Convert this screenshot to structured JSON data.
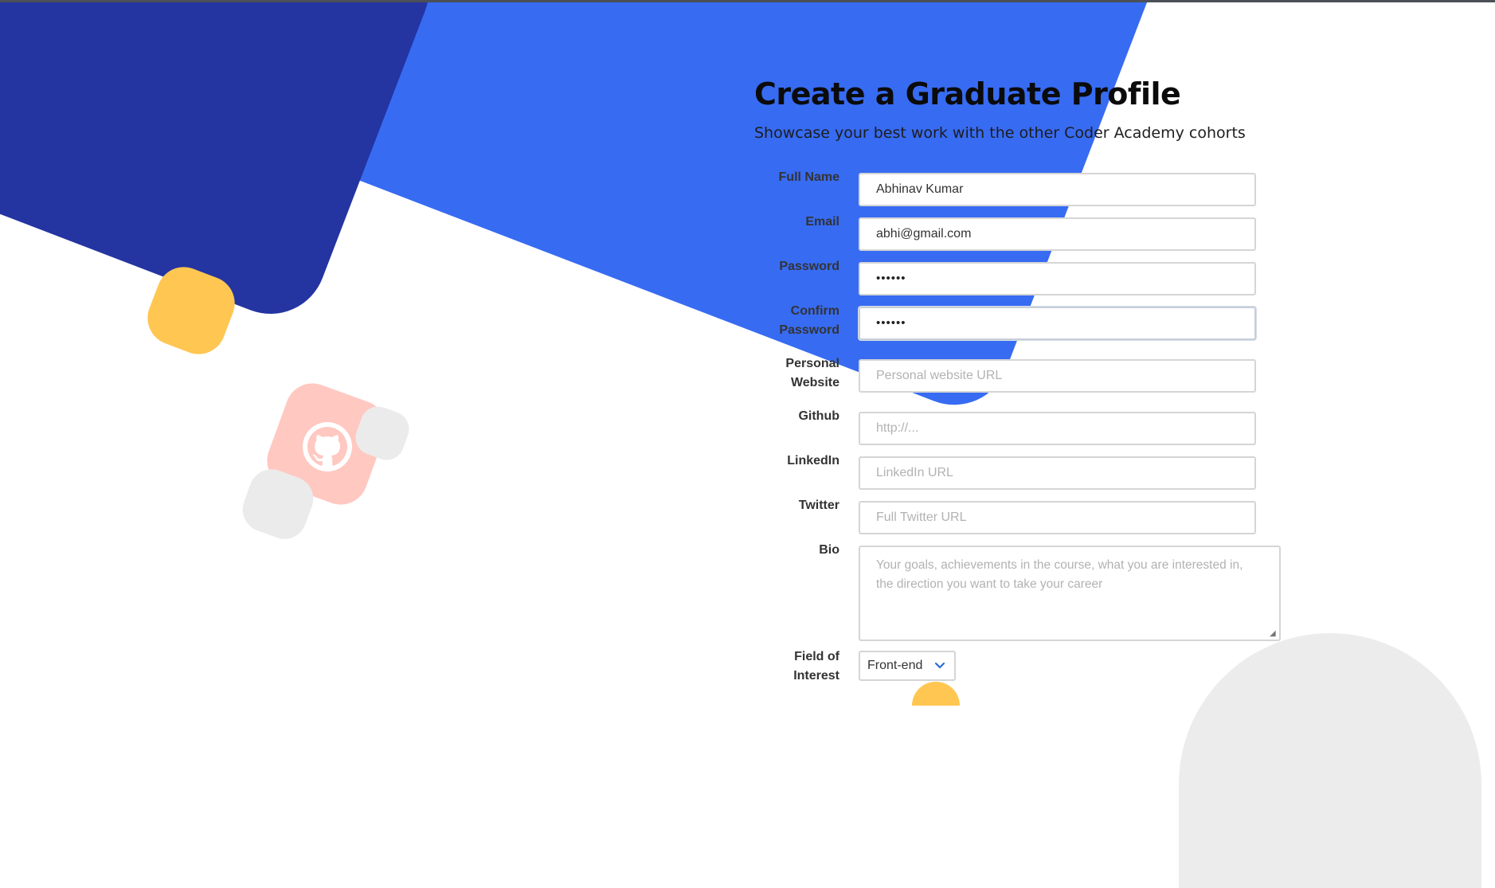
{
  "page": {
    "title": "Create a Graduate Profile",
    "subtitle": "Showcase your best work with the other Coder Academy cohorts"
  },
  "form": {
    "full_name": {
      "label": "Full Name",
      "value": "Abhinav Kumar"
    },
    "email": {
      "label": "Email",
      "value": "abhi@gmail.com"
    },
    "password": {
      "label": "Password",
      "value": "••••••"
    },
    "confirm_password": {
      "label_line1": "Confirm",
      "label_line2": "Password",
      "value": "••••••"
    },
    "personal_website": {
      "label_line1": "Personal",
      "label_line2": "Website",
      "placeholder": "Personal website URL"
    },
    "github": {
      "label": "Github",
      "placeholder": "http://..."
    },
    "linkedin": {
      "label": "LinkedIn",
      "placeholder": "LinkedIn URL"
    },
    "twitter": {
      "label": "Twitter",
      "placeholder": "Full Twitter URL"
    },
    "bio": {
      "label": "Bio",
      "placeholder": "Your goals, achievements in the course, what you are interested in, the direction you want to take your career"
    },
    "field_of_interest": {
      "label_line1": "Field of",
      "label_line2": "Interest",
      "selected": "Front-end"
    }
  },
  "icons": {
    "decor": "github-icon",
    "select": "chevron-down-icon"
  },
  "colors": {
    "blue": "#376bf2",
    "navy": "#2434a1",
    "yellow": "#ffc651",
    "pink": "#ffc8c1",
    "chevron": "#2b6cd8"
  }
}
